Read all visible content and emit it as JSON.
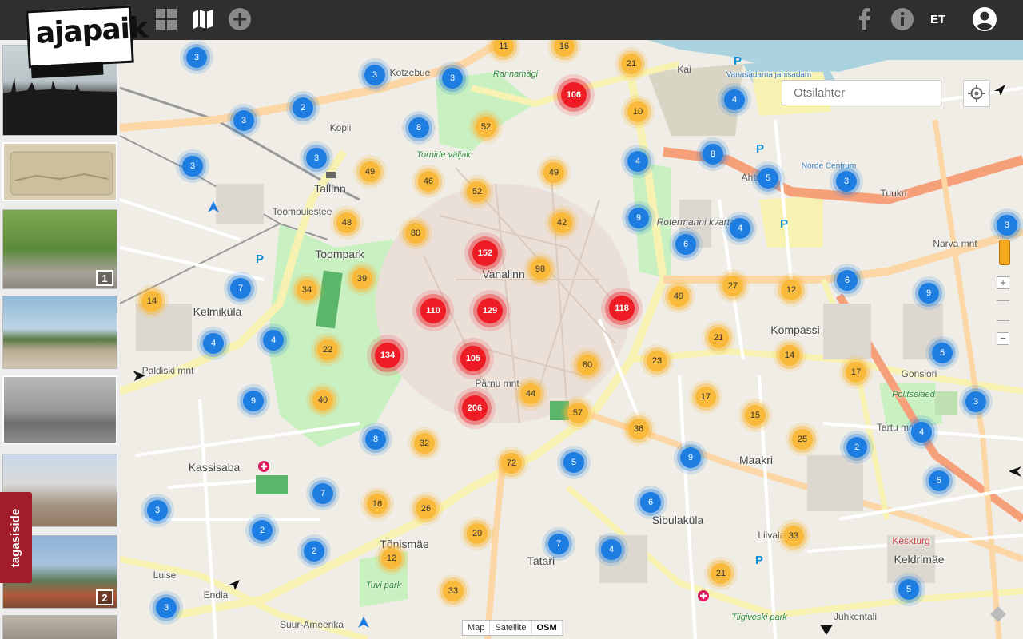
{
  "header": {
    "logo_text": "ajapaik",
    "lang": "ET",
    "icons": [
      "grid-icon",
      "map-icon",
      "add-icon",
      "facebook-icon",
      "info-icon",
      "user-icon"
    ]
  },
  "sidebar": {
    "thumbnails": [
      {
        "badge": ""
      },
      {
        "badge": ""
      },
      {
        "badge": "1"
      },
      {
        "badge": ""
      },
      {
        "badge": ""
      },
      {
        "badge": ""
      },
      {
        "badge": "2"
      },
      {
        "badge": ""
      }
    ],
    "feedback_label": "tagasiside"
  },
  "map": {
    "search_placeholder": "Otsilahter",
    "map_types": [
      "Map",
      "Satellite",
      "OSM"
    ],
    "selected_map_type": "OSM",
    "labels": [
      {
        "text": "Tallinn",
        "kind": "big"
      },
      {
        "text": "Toompark",
        "kind": "big"
      },
      {
        "text": "Vanalinn",
        "kind": "big"
      },
      {
        "text": "Kelmiküla",
        "kind": "big"
      },
      {
        "text": "Kompassi",
        "kind": "big"
      },
      {
        "text": "Maakri",
        "kind": "big"
      },
      {
        "text": "Sibulaküla",
        "kind": "big"
      },
      {
        "text": "Tõnismäe",
        "kind": "big"
      },
      {
        "text": "Tatari",
        "kind": "big"
      },
      {
        "text": "Keldrimäe",
        "kind": "big"
      },
      {
        "text": "Kassisaba",
        "kind": "big"
      },
      {
        "text": "Rannamägi",
        "kind": "green"
      },
      {
        "text": "Tornide väljak",
        "kind": "green"
      },
      {
        "text": "Tuvi park",
        "kind": "green"
      },
      {
        "text": "Politseiaed",
        "kind": "green"
      },
      {
        "text": "Rotermanni kvartal",
        "kind": "normal"
      },
      {
        "text": "Narva mnt",
        "kind": "normal"
      },
      {
        "text": "Gonsiori",
        "kind": "normal"
      },
      {
        "text": "Tartu mnt",
        "kind": "normal"
      },
      {
        "text": "Pärnu mnt",
        "kind": "normal"
      },
      {
        "text": "Toompuiestee",
        "kind": "normal"
      },
      {
        "text": "Paldiski mnt",
        "kind": "normal"
      },
      {
        "text": "Endla",
        "kind": "normal"
      },
      {
        "text": "Luise",
        "kind": "normal"
      },
      {
        "text": "Liivalaia",
        "kind": "normal"
      },
      {
        "text": "Kotzebue",
        "kind": "normal"
      },
      {
        "text": "Kopli",
        "kind": "normal"
      },
      {
        "text": "Ahtri",
        "kind": "normal"
      },
      {
        "text": "Tuukri",
        "kind": "normal"
      },
      {
        "text": "Kai",
        "kind": "normal"
      },
      {
        "text": "Suur-Ameerika",
        "kind": "normal"
      },
      {
        "text": "Juhkentali",
        "kind": "normal"
      },
      {
        "text": "Keskturg",
        "kind": "normal"
      },
      {
        "text": "Vanasadama jahisadam",
        "kind": "normal"
      },
      {
        "text": "Norde Centrum",
        "kind": "normal"
      },
      {
        "text": "Tiigiveski park",
        "kind": "green"
      }
    ],
    "clusters": [
      {
        "n": "3",
        "c": "blue"
      },
      {
        "n": "11",
        "c": "orange"
      },
      {
        "n": "16",
        "c": "orange"
      },
      {
        "n": "21",
        "c": "orange"
      },
      {
        "n": "3",
        "c": "blue"
      },
      {
        "n": "3",
        "c": "blue"
      },
      {
        "n": "106",
        "c": "red"
      },
      {
        "n": "2",
        "c": "blue"
      },
      {
        "n": "3",
        "c": "blue"
      },
      {
        "n": "8",
        "c": "blue"
      },
      {
        "n": "52",
        "c": "orange"
      },
      {
        "n": "10",
        "c": "orange"
      },
      {
        "n": "4",
        "c": "blue"
      },
      {
        "n": "3",
        "c": "blue"
      },
      {
        "n": "3",
        "c": "blue"
      },
      {
        "n": "49",
        "c": "orange"
      },
      {
        "n": "46",
        "c": "orange"
      },
      {
        "n": "52",
        "c": "orange"
      },
      {
        "n": "49",
        "c": "orange"
      },
      {
        "n": "4",
        "c": "blue"
      },
      {
        "n": "8",
        "c": "blue"
      },
      {
        "n": "5",
        "c": "blue"
      },
      {
        "n": "3",
        "c": "blue"
      },
      {
        "n": "48",
        "c": "orange"
      },
      {
        "n": "80",
        "c": "orange"
      },
      {
        "n": "42",
        "c": "orange"
      },
      {
        "n": "9",
        "c": "blue"
      },
      {
        "n": "4",
        "c": "blue"
      },
      {
        "n": "3",
        "c": "blue"
      },
      {
        "n": "152",
        "c": "red"
      },
      {
        "n": "98",
        "c": "orange"
      },
      {
        "n": "6",
        "c": "blue"
      },
      {
        "n": "39",
        "c": "orange"
      },
      {
        "n": "34",
        "c": "orange"
      },
      {
        "n": "7",
        "c": "blue"
      },
      {
        "n": "110",
        "c": "red"
      },
      {
        "n": "129",
        "c": "red"
      },
      {
        "n": "118",
        "c": "red"
      },
      {
        "n": "49",
        "c": "orange"
      },
      {
        "n": "27",
        "c": "orange"
      },
      {
        "n": "12",
        "c": "orange"
      },
      {
        "n": "6",
        "c": "blue"
      },
      {
        "n": "9",
        "c": "blue"
      },
      {
        "n": "14",
        "c": "orange"
      },
      {
        "n": "4",
        "c": "blue"
      },
      {
        "n": "4",
        "c": "blue"
      },
      {
        "n": "22",
        "c": "orange"
      },
      {
        "n": "134",
        "c": "red"
      },
      {
        "n": "105",
        "c": "red"
      },
      {
        "n": "80",
        "c": "orange"
      },
      {
        "n": "23",
        "c": "orange"
      },
      {
        "n": "21",
        "c": "orange"
      },
      {
        "n": "14",
        "c": "orange"
      },
      {
        "n": "17",
        "c": "orange"
      },
      {
        "n": "5",
        "c": "blue"
      },
      {
        "n": "9",
        "c": "blue"
      },
      {
        "n": "40",
        "c": "orange"
      },
      {
        "n": "44",
        "c": "orange"
      },
      {
        "n": "206",
        "c": "red"
      },
      {
        "n": "57",
        "c": "orange"
      },
      {
        "n": "17",
        "c": "orange"
      },
      {
        "n": "15",
        "c": "orange"
      },
      {
        "n": "3",
        "c": "blue"
      },
      {
        "n": "36",
        "c": "orange"
      },
      {
        "n": "25",
        "c": "orange"
      },
      {
        "n": "4",
        "c": "blue"
      },
      {
        "n": "8",
        "c": "blue"
      },
      {
        "n": "32",
        "c": "orange"
      },
      {
        "n": "2",
        "c": "blue"
      },
      {
        "n": "9",
        "c": "blue"
      },
      {
        "n": "72",
        "c": "orange"
      },
      {
        "n": "5",
        "c": "blue"
      },
      {
        "n": "5",
        "c": "blue"
      },
      {
        "n": "7",
        "c": "blue"
      },
      {
        "n": "16",
        "c": "orange"
      },
      {
        "n": "26",
        "c": "orange"
      },
      {
        "n": "6",
        "c": "blue"
      },
      {
        "n": "3",
        "c": "blue"
      },
      {
        "n": "2",
        "c": "blue"
      },
      {
        "n": "20",
        "c": "orange"
      },
      {
        "n": "33",
        "c": "orange"
      },
      {
        "n": "2",
        "c": "blue"
      },
      {
        "n": "12",
        "c": "orange"
      },
      {
        "n": "7",
        "c": "blue"
      },
      {
        "n": "4",
        "c": "blue"
      },
      {
        "n": "21",
        "c": "orange"
      },
      {
        "n": "3",
        "c": "blue"
      },
      {
        "n": "33",
        "c": "orange"
      },
      {
        "n": "5",
        "c": "blue"
      }
    ]
  },
  "colors": {
    "topbar": "#2f2f2f",
    "cluster_blue": "#1e7de0",
    "cluster_orange": "#f9b93b",
    "cluster_red": "#ee1c25",
    "feedback": "#a11d2b"
  }
}
